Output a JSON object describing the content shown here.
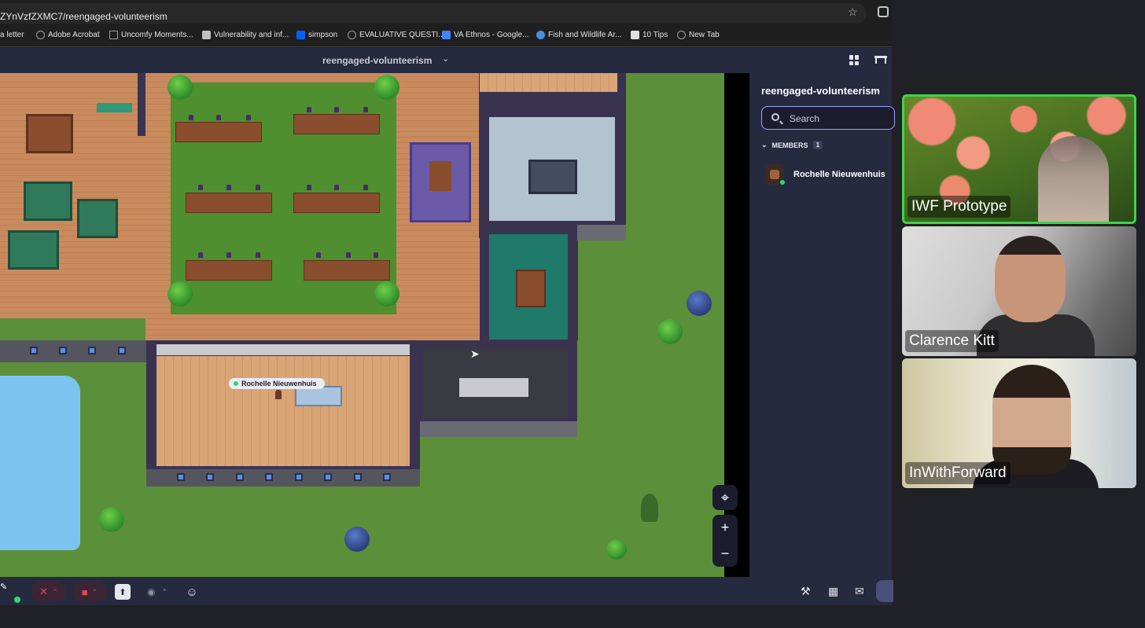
{
  "browser": {
    "url": "ZYnVzfZXMC7/reengaged-volunteerism",
    "bookmarks": [
      {
        "label": "a letter",
        "icon": "",
        "color": "#9aa0a6"
      },
      {
        "label": "Adobe Acrobat",
        "icon": "globe-icon",
        "color": "#9aa0a6"
      },
      {
        "label": "Uncomfy Moments...",
        "icon": "folder-icon",
        "color": "#9aa0a6"
      },
      {
        "label": "Vulnerability and inf...",
        "icon": "site-icon",
        "color": "#c0c0c0"
      },
      {
        "label": "simpson",
        "icon": "dropbox-icon",
        "color": "#0061fe"
      },
      {
        "label": "EVALUATIVE QUESTI...",
        "icon": "globe-icon",
        "color": "#9aa0a6"
      },
      {
        "label": "VA Ethnos - Google...",
        "icon": "google-docs-icon",
        "color": "#4285f4"
      },
      {
        "label": "Fish and Wildlife Ar...",
        "icon": "site-icon",
        "color": "#4a90e2"
      },
      {
        "label": "10 Tips",
        "icon": "site-icon",
        "color": "#e0e0e0"
      },
      {
        "label": "New Tab",
        "icon": "globe-icon",
        "color": "#9aa0a6"
      }
    ]
  },
  "header": {
    "space_name": "reengaged-volunteerism"
  },
  "map": {
    "nametag": "Rochelle Nieuwenhuis",
    "locate_icon": "⌖",
    "zoom_in": "+",
    "zoom_out": "−"
  },
  "sidebar": {
    "title": "reengaged-volunteerism",
    "search_placeholder": "Search",
    "members_label": "MEMBERS",
    "members_count": "1",
    "members": [
      {
        "name": "Rochelle Nieuwenhuis",
        "online": true
      }
    ]
  },
  "video_tiles": [
    {
      "name": "IWF Prototype",
      "active_speaker": true
    },
    {
      "name": "Clarence Kitt",
      "active_speaker": false
    },
    {
      "name": "InWithForward",
      "active_speaker": false
    }
  ],
  "colors": {
    "accent_green": "#3fd34c",
    "app_bg": "#262a3f",
    "muted_red": "#e3455f",
    "online": "#2fd57b"
  }
}
